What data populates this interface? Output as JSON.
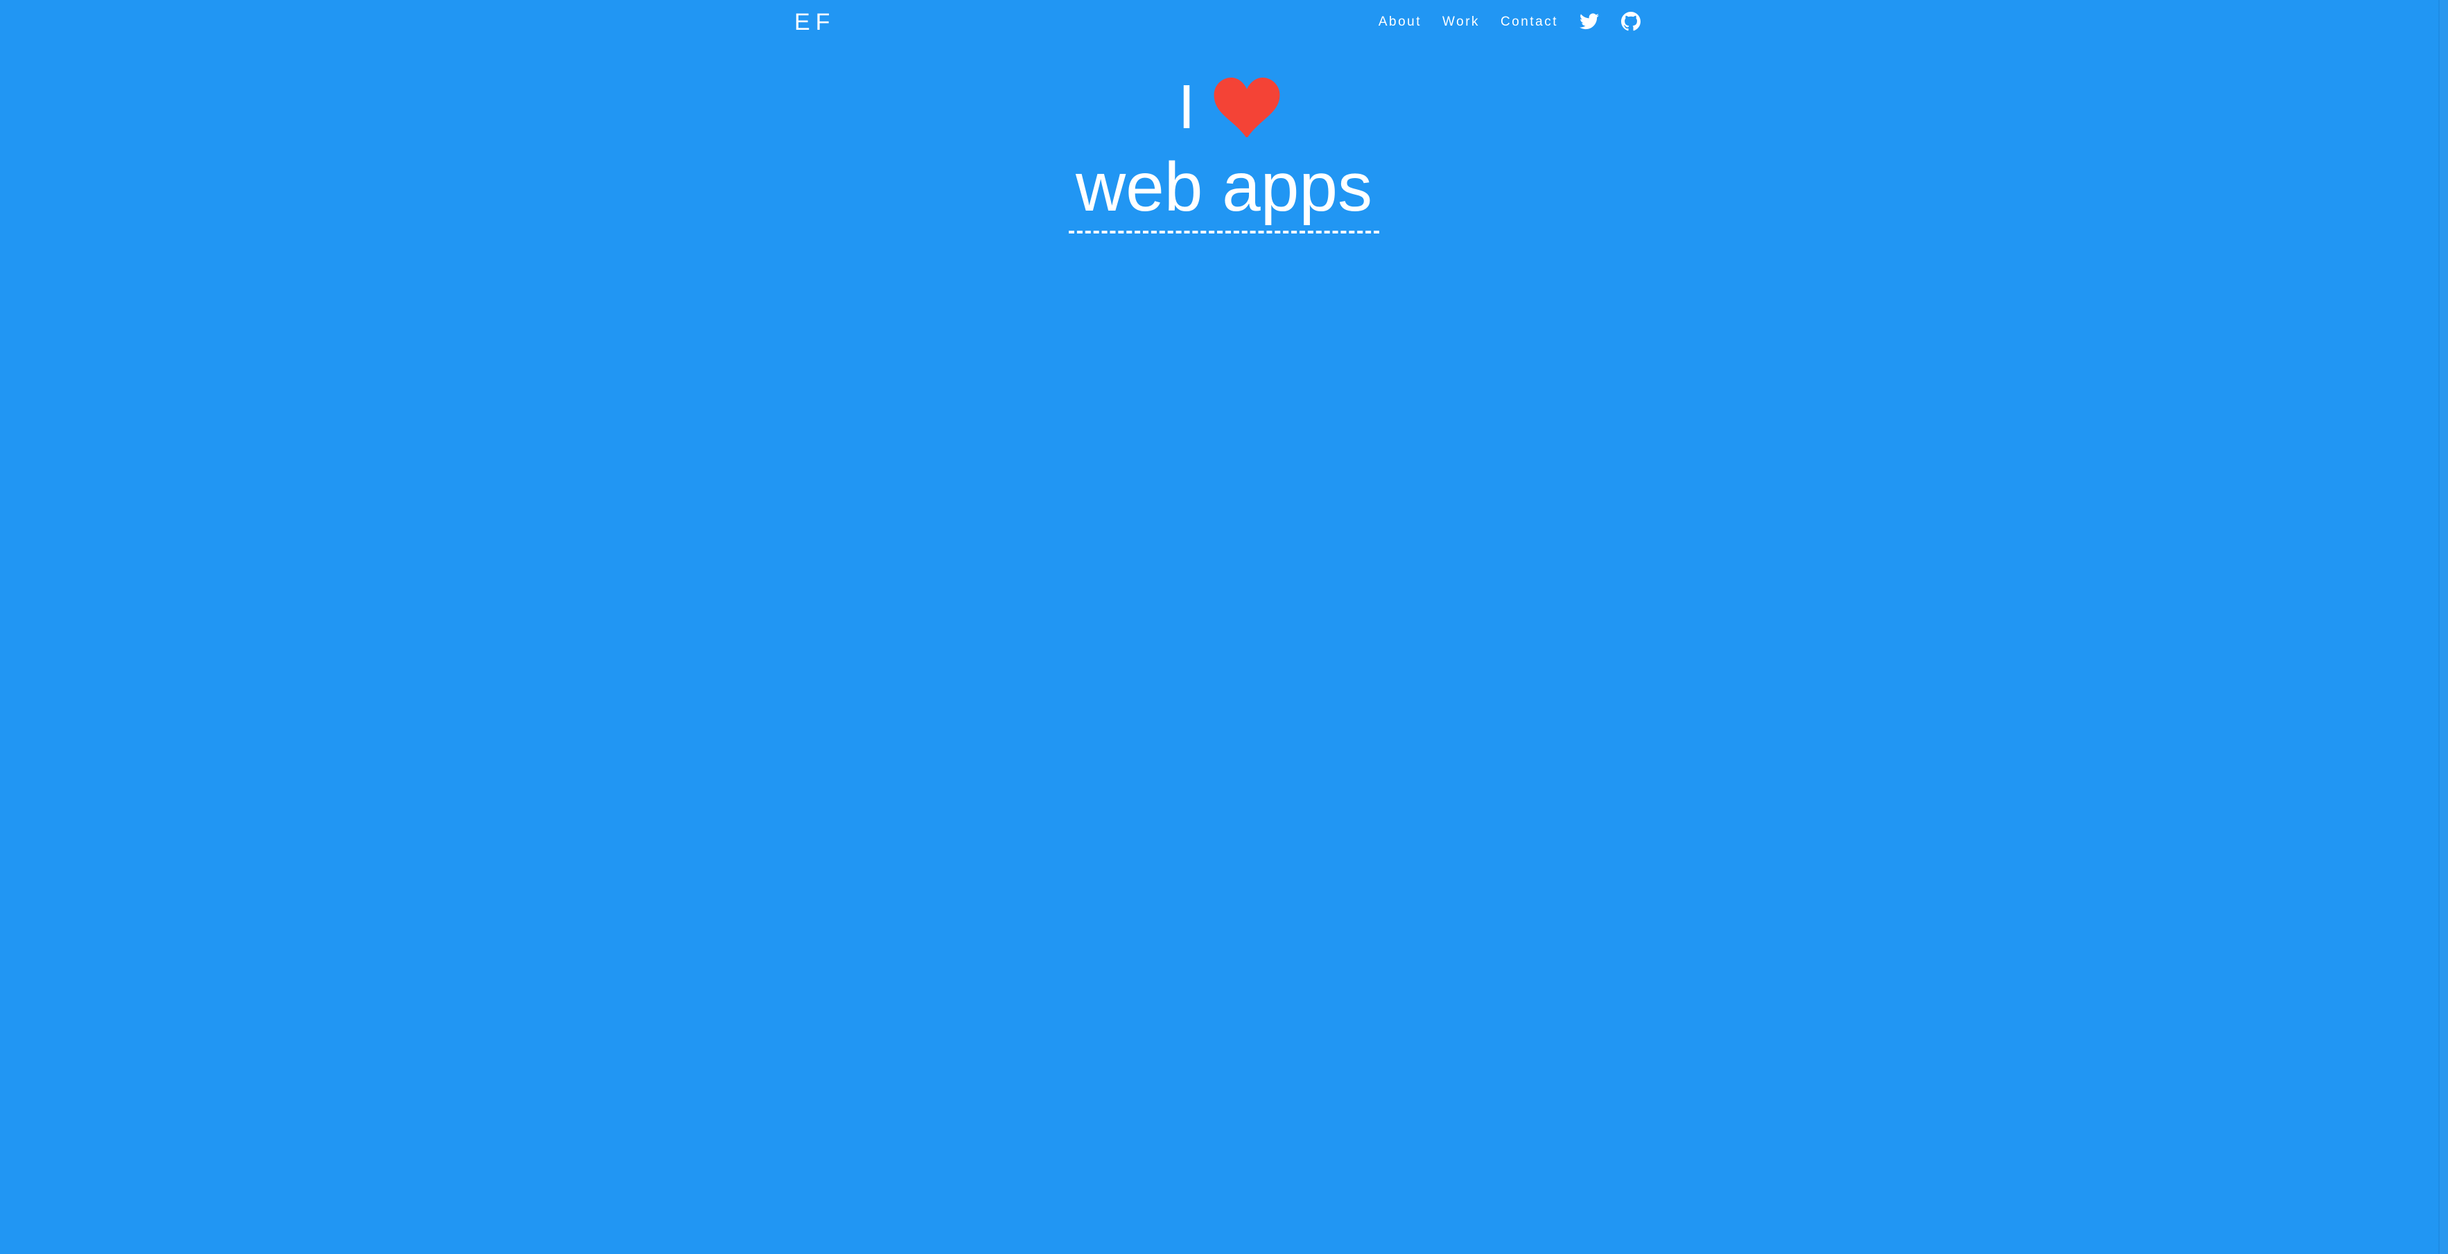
{
  "navbar": {
    "brand": "EF",
    "links": [
      {
        "label": "About"
      },
      {
        "label": "Work"
      },
      {
        "label": "Contact"
      }
    ],
    "social": [
      {
        "icon": "twitter-icon"
      },
      {
        "icon": "github-icon"
      }
    ]
  },
  "hero": {
    "prefix": "I",
    "heart_icon": "heart-icon",
    "heart_color": "#f44336",
    "rotating_word": "web apps"
  },
  "colors": {
    "background": "#2196f3",
    "text": "#ffffff"
  }
}
